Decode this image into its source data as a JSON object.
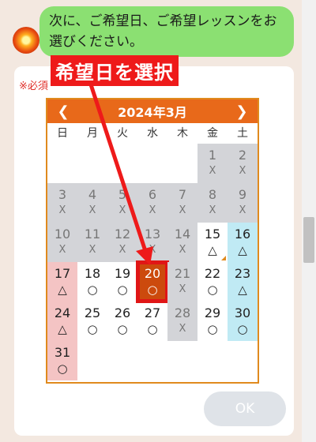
{
  "chat": {
    "message": "次に、ご希望日、ご希望レッスンをお選びください。"
  },
  "form": {
    "required_label": "※必須",
    "ok_label": "OK"
  },
  "annotation": {
    "text": "希望日を選択"
  },
  "calendar": {
    "title": "2024年3月",
    "prev_icon": "chevron-left-icon",
    "next_icon": "chevron-right-icon",
    "weekdays": [
      "日",
      "月",
      "火",
      "水",
      "木",
      "金",
      "土"
    ],
    "selected_day": "20",
    "weeks": [
      [
        {
          "day": "",
          "mark": "",
          "state": "empty"
        },
        {
          "day": "",
          "mark": "",
          "state": "empty"
        },
        {
          "day": "",
          "mark": "",
          "state": "empty"
        },
        {
          "day": "",
          "mark": "",
          "state": "empty"
        },
        {
          "day": "",
          "mark": "",
          "state": "empty"
        },
        {
          "day": "1",
          "mark": "X",
          "state": "closed"
        },
        {
          "day": "2",
          "mark": "X",
          "state": "closed"
        }
      ],
      [
        {
          "day": "3",
          "mark": "X",
          "state": "closed"
        },
        {
          "day": "4",
          "mark": "X",
          "state": "closed"
        },
        {
          "day": "5",
          "mark": "X",
          "state": "closed"
        },
        {
          "day": "6",
          "mark": "X",
          "state": "closed"
        },
        {
          "day": "7",
          "mark": "X",
          "state": "closed"
        },
        {
          "day": "8",
          "mark": "X",
          "state": "closed"
        },
        {
          "day": "9",
          "mark": "X",
          "state": "closed"
        }
      ],
      [
        {
          "day": "10",
          "mark": "X",
          "state": "closed"
        },
        {
          "day": "11",
          "mark": "X",
          "state": "closed"
        },
        {
          "day": "12",
          "mark": "X",
          "state": "closed"
        },
        {
          "day": "13",
          "mark": "X",
          "state": "closed"
        },
        {
          "day": "14",
          "mark": "X",
          "state": "closed"
        },
        {
          "day": "15",
          "mark": "△",
          "state": "open",
          "corner": true
        },
        {
          "day": "16",
          "mark": "△",
          "state": "saturday"
        }
      ],
      [
        {
          "day": "17",
          "mark": "△",
          "state": "sunday"
        },
        {
          "day": "18",
          "mark": "○",
          "state": "open"
        },
        {
          "day": "19",
          "mark": "○",
          "state": "open"
        },
        {
          "day": "20",
          "mark": "○",
          "state": "selected"
        },
        {
          "day": "21",
          "mark": "X",
          "state": "closed"
        },
        {
          "day": "22",
          "mark": "○",
          "state": "open"
        },
        {
          "day": "23",
          "mark": "△",
          "state": "saturday"
        }
      ],
      [
        {
          "day": "24",
          "mark": "△",
          "state": "sunday"
        },
        {
          "day": "25",
          "mark": "○",
          "state": "open"
        },
        {
          "day": "26",
          "mark": "○",
          "state": "open"
        },
        {
          "day": "27",
          "mark": "○",
          "state": "open"
        },
        {
          "day": "28",
          "mark": "X",
          "state": "closed"
        },
        {
          "day": "29",
          "mark": "○",
          "state": "open"
        },
        {
          "day": "30",
          "mark": "○",
          "state": "saturday"
        }
      ],
      [
        {
          "day": "31",
          "mark": "○",
          "state": "sunday"
        },
        {
          "day": "",
          "mark": "",
          "state": "empty"
        },
        {
          "day": "",
          "mark": "",
          "state": "empty"
        },
        {
          "day": "",
          "mark": "",
          "state": "empty"
        },
        {
          "day": "",
          "mark": "",
          "state": "empty"
        },
        {
          "day": "",
          "mark": "",
          "state": "empty"
        },
        {
          "day": "",
          "mark": "",
          "state": "empty"
        }
      ]
    ]
  },
  "colors": {
    "header": "#e8691a",
    "selected": "#cc4a0d",
    "closed": "#d3d4d8",
    "sunday": "#f4c4c4",
    "saturday": "#c0eaf4",
    "annotation": "#ee1a1a"
  }
}
